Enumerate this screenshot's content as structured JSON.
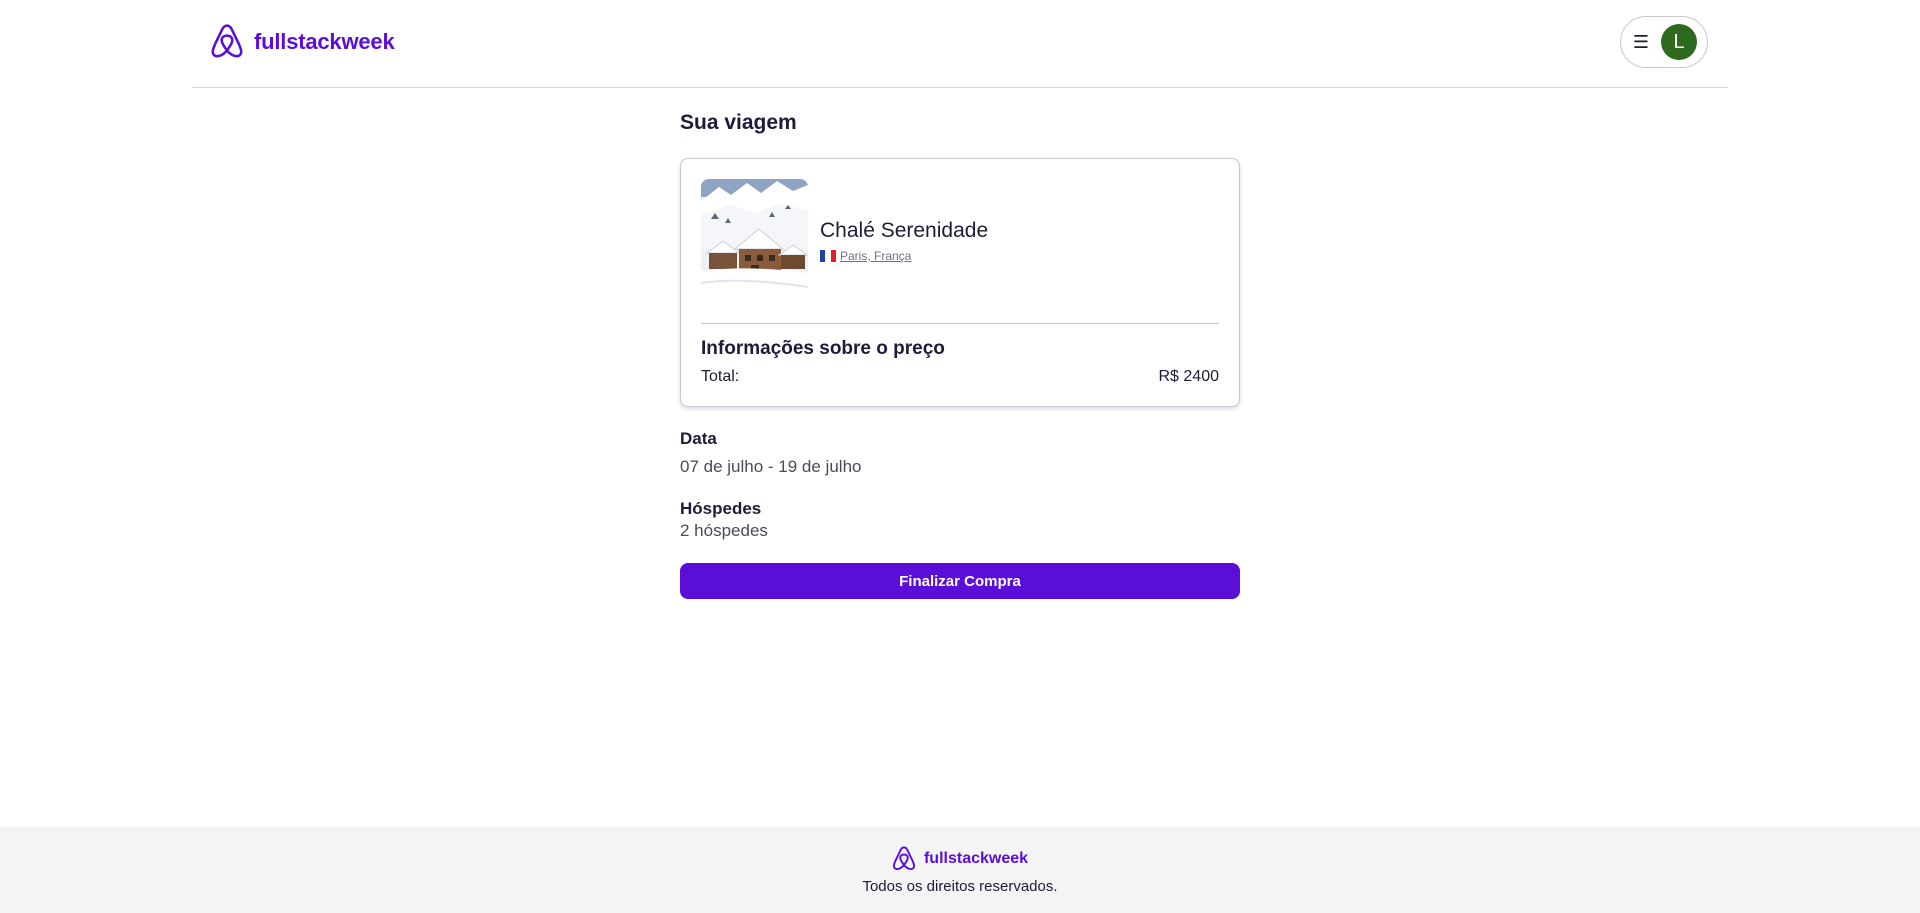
{
  "header": {
    "brand": "fullstackweek",
    "menu_icon": "hamburger-icon",
    "avatar_initial": "L"
  },
  "main": {
    "title": "Sua viagem",
    "trip": {
      "name": "Chalé Serenidade",
      "location": "Paris, França",
      "image": "snowy-chalet-image"
    },
    "price": {
      "title": "Informações sobre o preço",
      "total_label": "Total:",
      "total_value": "R$ 2400"
    },
    "date": {
      "label": "Data",
      "value": "07 de julho - 19 de julho"
    },
    "guests": {
      "label": "Hóspedes",
      "value": "2 hóspedes"
    },
    "cta_label": "Finalizar Compra"
  },
  "footer": {
    "brand": "fullstackweek",
    "copyright": "Todos os direitos reservados."
  },
  "colors": {
    "brand": "#5a0ed8",
    "avatar": "#2d6a1e",
    "text": "#1f1b3a",
    "footer_bg": "#f4f4f5"
  }
}
